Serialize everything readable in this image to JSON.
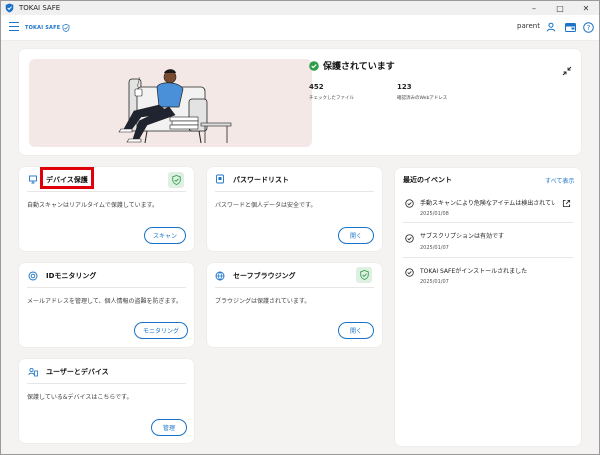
{
  "window": {
    "title": "TOKAI SAFE",
    "controls": [
      "–",
      "□",
      "✕"
    ]
  },
  "header": {
    "brand": "TOKAI SAFE",
    "user": "parent"
  },
  "hero": {
    "status": "保護されています",
    "stats": [
      {
        "value": "452",
        "label": "チェックしたファイル"
      },
      {
        "value": "123",
        "label": "確認済みのWebアドレス"
      }
    ]
  },
  "features": {
    "device": {
      "title": "デバイス保護",
      "desc": "自動スキャンはリアルタイムで保護しています。",
      "button": "スキャン"
    },
    "password": {
      "title": "パスワードリスト",
      "desc": "パスワードと個人データは安全です。",
      "button": "開く"
    },
    "id_monitor": {
      "title": "IDモニタリング",
      "desc": "メールアドレスを管理して、個人情報の盗難を防ぎます。",
      "button": "モニタリング"
    },
    "safe_browsing": {
      "title": "セーフブラウジング",
      "desc": "ブラウジングは保護されています。",
      "button": "開く"
    },
    "users": {
      "title": "ユーザーとデバイス",
      "desc": "保護している&デバイスはこちらです。",
      "button": "管理"
    }
  },
  "events": {
    "title": "最近のイベント",
    "view_all": "すべて表示",
    "items": [
      {
        "text": "手動スキャンにより危険なアイテムは検出されてい...",
        "date": "2025/01/08"
      },
      {
        "text": "サブスクリプションは有効です",
        "date": "2025/01/07"
      },
      {
        "text": "TOKAI SAFEがインストールされました",
        "date": "2025/01/07"
      }
    ]
  },
  "colors": {
    "accent": "#1a73c8",
    "ok": "#2e9e4a",
    "highlight": "#e0000a"
  }
}
